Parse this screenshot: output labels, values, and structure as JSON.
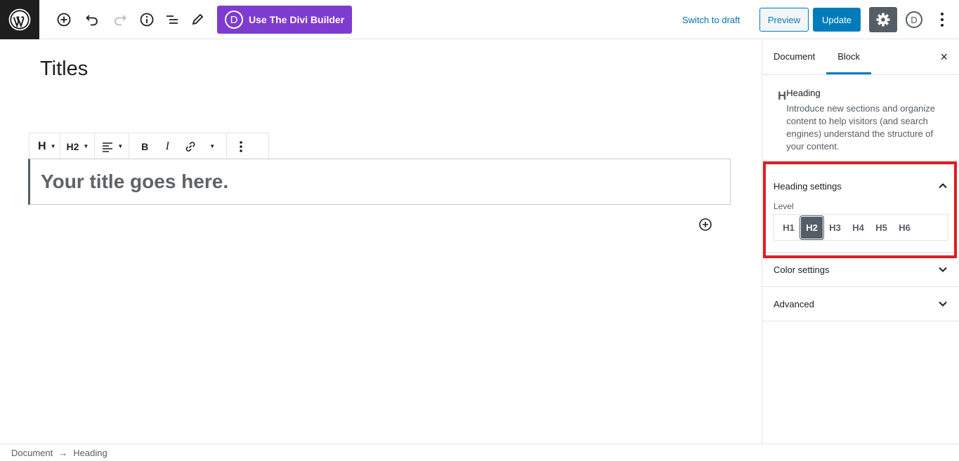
{
  "header": {
    "divi_button_label": "Use The Divi Builder",
    "divi_letter": "D",
    "switch_to_draft": "Switch to draft",
    "preview": "Preview",
    "update": "Update",
    "avatar_letter": "D"
  },
  "editor": {
    "post_title": "Titles",
    "heading_text": "Your title goes here.",
    "toolbar": {
      "block_type_icon": "H",
      "level_label": "H2",
      "bold_label": "B",
      "italic_label": "I"
    }
  },
  "sidebar": {
    "tabs": [
      {
        "label": "Document"
      },
      {
        "label": "Block"
      }
    ],
    "close_icon": "×",
    "block_card": {
      "icon": "H",
      "title": "Heading",
      "description": "Introduce new sections and organize content to help visitors (and search engines) understand the structure of your content."
    },
    "heading_settings": {
      "title": "Heading settings",
      "level_label": "Level",
      "levels": [
        "H1",
        "H2",
        "H3",
        "H4",
        "H5",
        "H6"
      ],
      "selected": "H2"
    },
    "color_settings": {
      "title": "Color settings"
    },
    "advanced": {
      "title": "Advanced"
    }
  },
  "footer": {
    "breadcrumb": [
      "Document",
      "Heading"
    ],
    "separator": "→"
  },
  "colors": {
    "divi_purple": "#7e3bd0",
    "primary_blue": "#007cba",
    "highlight_red": "#e01e22",
    "dark_gray": "#555d66"
  }
}
